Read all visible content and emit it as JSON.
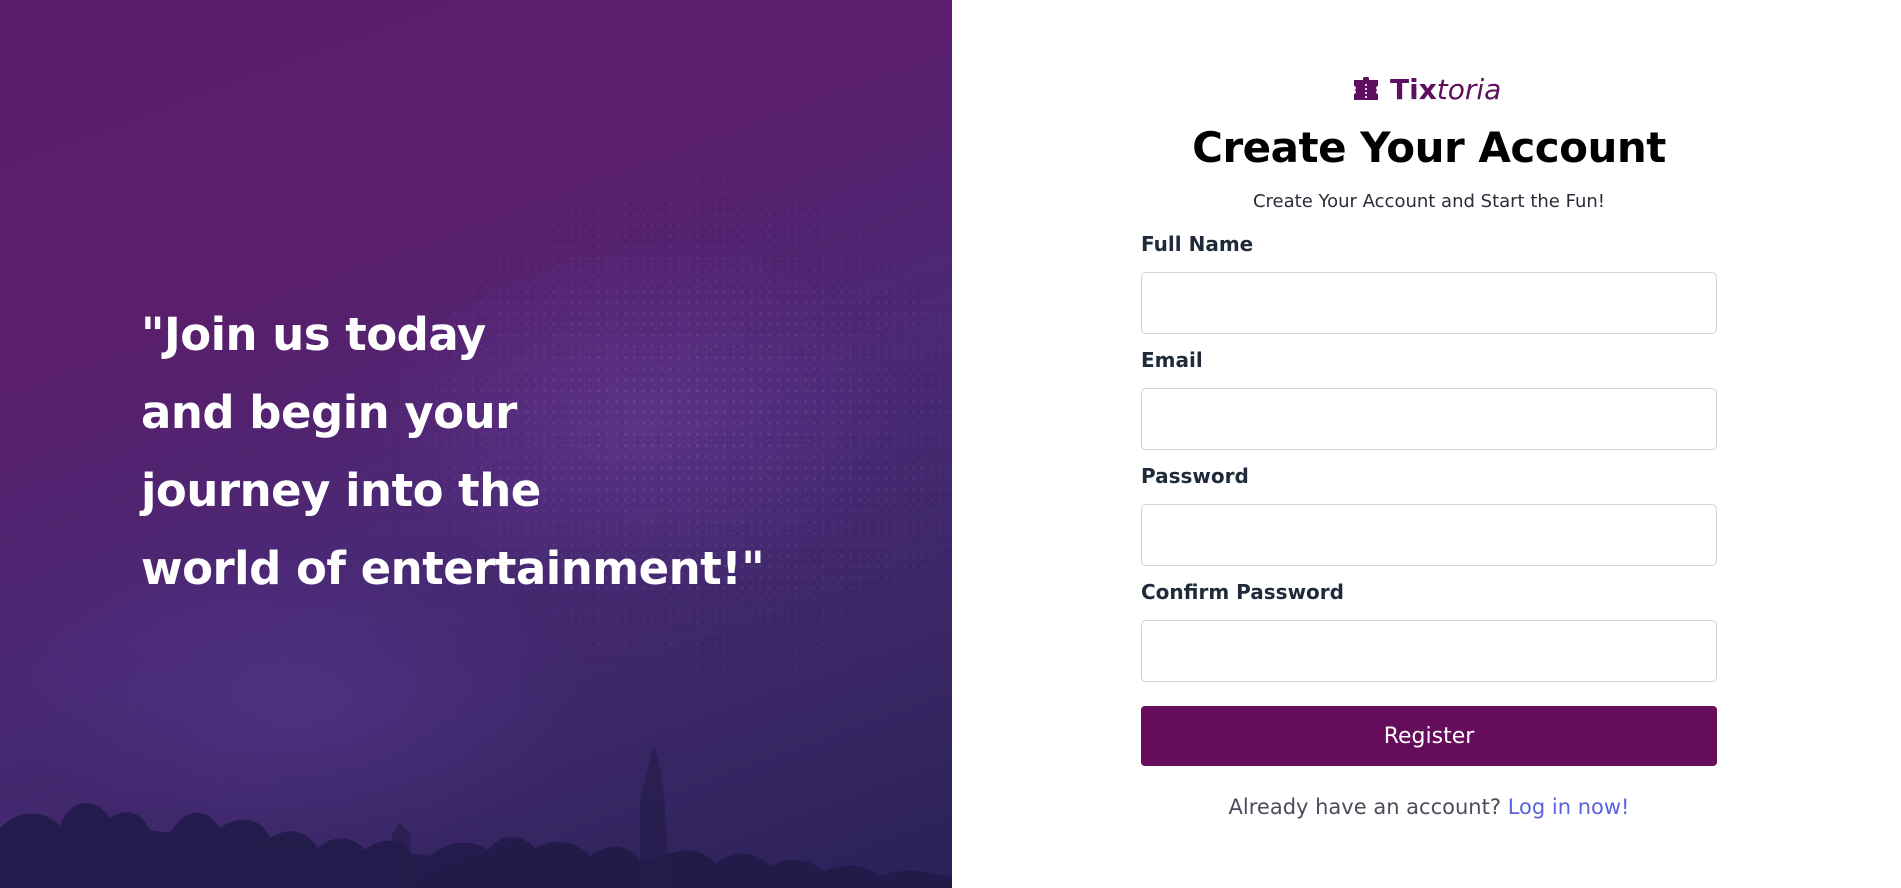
{
  "hero": {
    "quote_lines": [
      "\"Join us today",
      "and begin your",
      "journey into the",
      "world of entertainment!\""
    ]
  },
  "brand": {
    "name_bold": "Tix",
    "name_italic": "toria",
    "icon": "ticket-icon",
    "color": "#5e0f5f"
  },
  "form": {
    "title": "Create Your Account",
    "subtitle": "Create Your Account and Start the Fun!",
    "fields": [
      {
        "label": "Full Name",
        "value": "",
        "placeholder": ""
      },
      {
        "label": "Email",
        "value": "",
        "placeholder": ""
      },
      {
        "label": "Password",
        "value": "",
        "placeholder": ""
      },
      {
        "label": "Confirm Password",
        "value": "",
        "placeholder": ""
      }
    ],
    "submit_label": "Register",
    "footer_text": "Already have an account?",
    "login_link": "Log in now!"
  },
  "colors": {
    "primary": "#650d5a",
    "link": "#5a62e0",
    "hero_top": "#5a1d6e",
    "hero_bottom": "#2a2158"
  }
}
